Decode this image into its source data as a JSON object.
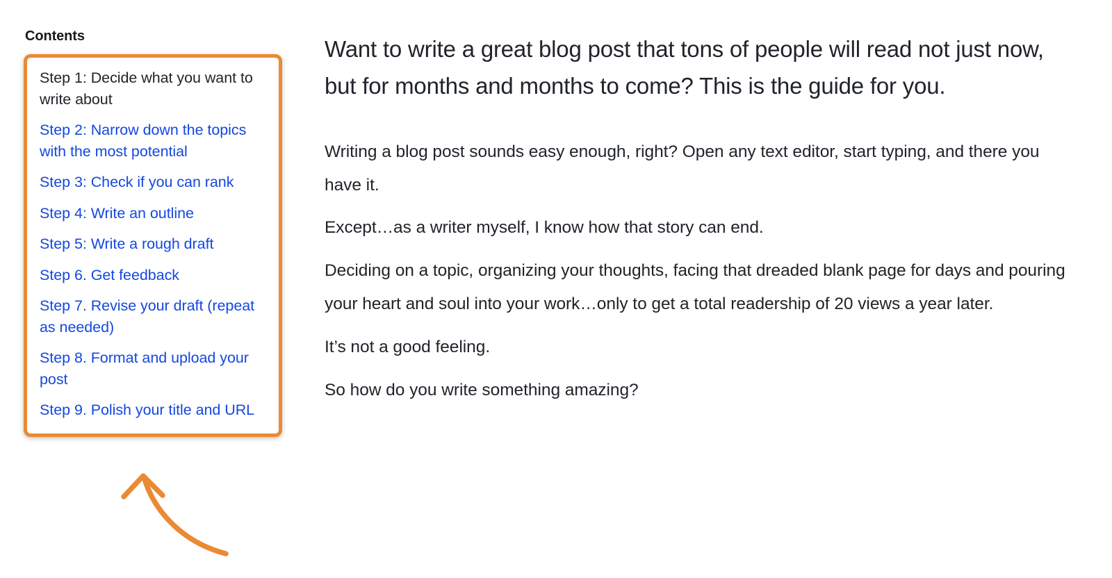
{
  "sidebar": {
    "heading": "Contents",
    "items": [
      {
        "label": "Step 1: Decide what you want to write about",
        "current": true
      },
      {
        "label": "Step 2: Narrow down the topics with the most potential",
        "current": false
      },
      {
        "label": "Step 3: Check if you can rank",
        "current": false
      },
      {
        "label": "Step 4: Write an outline",
        "current": false
      },
      {
        "label": "Step 5: Write a rough draft",
        "current": false
      },
      {
        "label": "Step 6. Get feedback",
        "current": false
      },
      {
        "label": "Step 7. Revise your draft (repeat as needed)",
        "current": false
      },
      {
        "label": "Step 8. Format and upload your post",
        "current": false
      },
      {
        "label": "Step 9. Polish your title and URL",
        "current": false
      }
    ]
  },
  "annotation": {
    "name": "curved-arrow-pointing-to-contents-box",
    "color": "#ea8a33"
  },
  "article": {
    "lead": "Want to write a great blog post that tons of people will read not just now, but for months and months to come? This is the guide for you.",
    "paragraphs": [
      "Writing a blog post sounds easy enough, right? Open any text editor, start typing, and there you have it.",
      "Except…as a writer myself, I know how that story can end.",
      "Deciding on a topic, organizing your thoughts, facing that dreaded blank page for days and pouring your heart and soul into your work…only to get a total readership of 20 views a year later.",
      "It’s not a good feeling.",
      "So how do you write something amazing?"
    ]
  },
  "colors": {
    "accent_orange": "#ea8a33",
    "link_blue": "#1448e0",
    "text_dark": "#20242a",
    "background": "#ffffff"
  }
}
